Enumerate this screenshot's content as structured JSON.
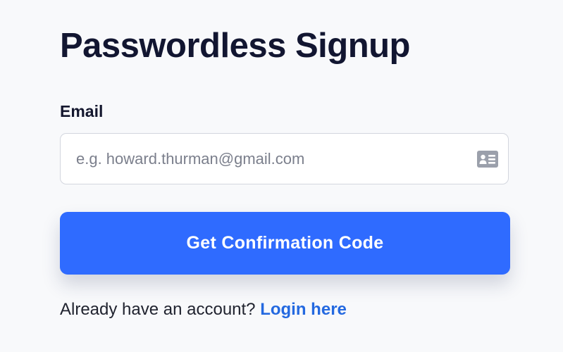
{
  "page": {
    "title": "Passwordless Signup"
  },
  "form": {
    "email_label": "Email",
    "email_placeholder": "e.g. howard.thurman@gmail.com",
    "email_value": "",
    "email_icon": "contact-card-icon",
    "submit_label": "Get Confirmation Code"
  },
  "footer": {
    "prompt": "Already have an account?",
    "login_link": "Login here"
  },
  "colors": {
    "background": "#f8f9fb",
    "primary_button": "#2f6bff",
    "link": "#2469e0",
    "title_text": "#121631"
  }
}
